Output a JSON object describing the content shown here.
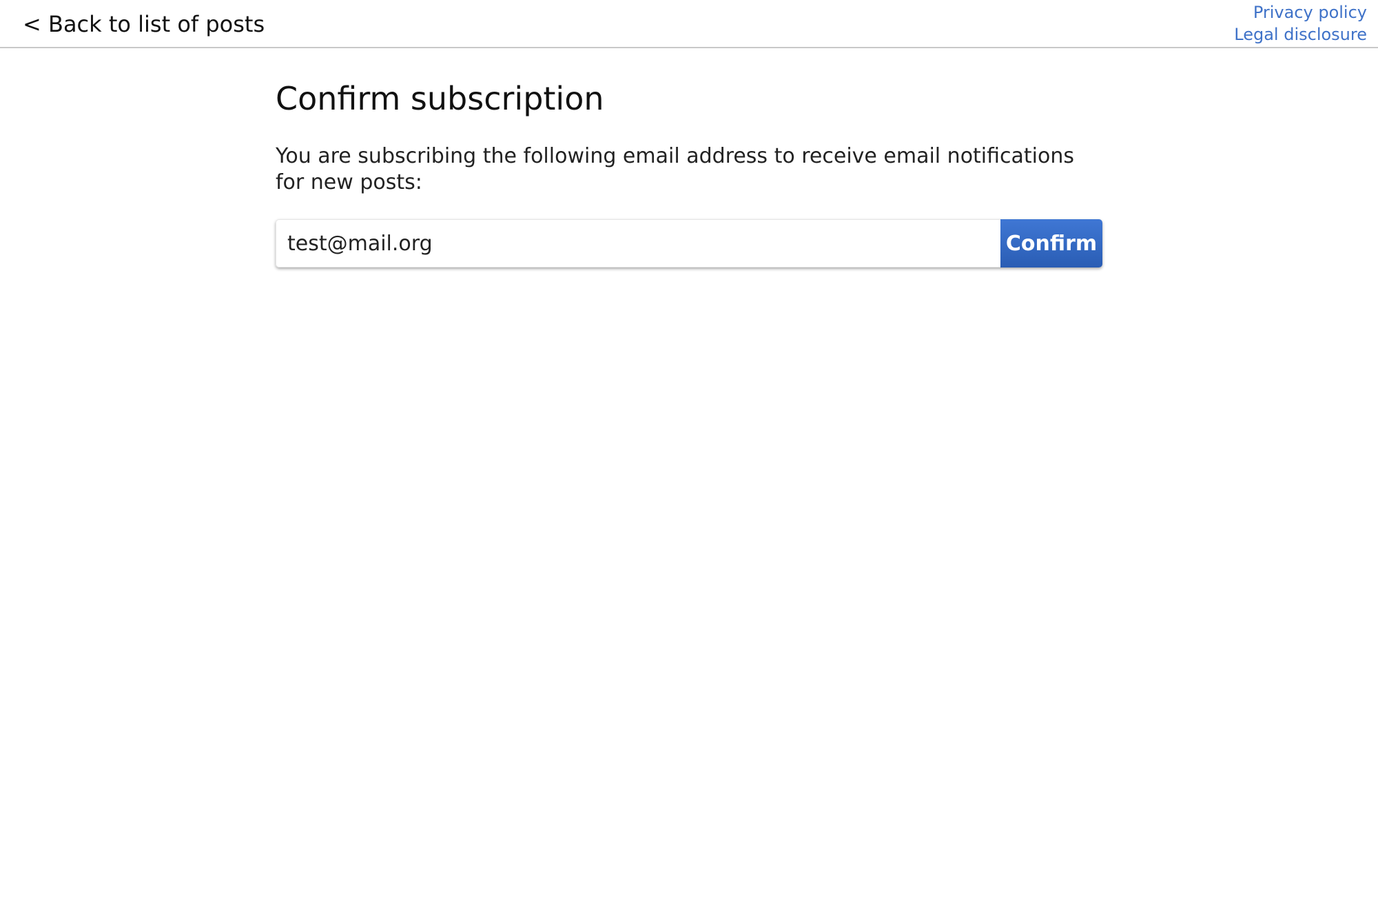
{
  "header": {
    "back_link_label": "< Back to list of posts",
    "privacy_policy_label": "Privacy policy",
    "legal_disclosure_label": "Legal disclosure"
  },
  "main": {
    "title": "Confirm subscription",
    "description": "You are subscribing the following email address to receive email notifications for new posts:",
    "email_value": "test@mail.org",
    "confirm_label": "Confirm"
  },
  "colors": {
    "link": "#3f72c8",
    "button": "#3366c4",
    "text": "#111111"
  }
}
